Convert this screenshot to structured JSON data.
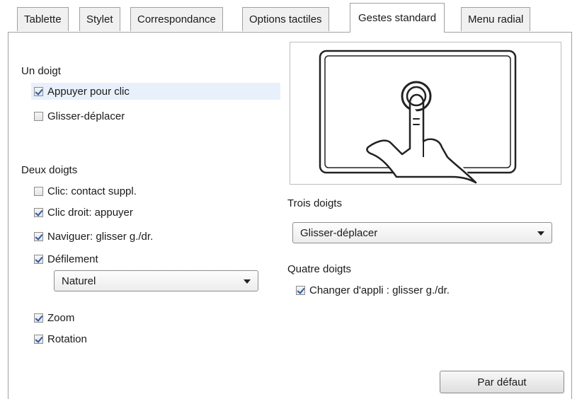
{
  "tabs": [
    {
      "label": "Tablette"
    },
    {
      "label": "Stylet"
    },
    {
      "label": "Correspondance"
    },
    {
      "label": "Options tactiles"
    },
    {
      "label": "Gestes standard"
    },
    {
      "label": "Menu radial"
    }
  ],
  "active_tab": "Gestes standard",
  "one_finger": {
    "title": "Un doigt",
    "options": [
      {
        "label": "Appuyer pour clic",
        "checked": true
      },
      {
        "label": "Glisser-déplacer",
        "checked": false
      }
    ]
  },
  "two_fingers": {
    "title": "Deux doigts",
    "options": [
      {
        "label": "Clic: contact suppl.",
        "checked": false
      },
      {
        "label": "Clic droit: appuyer",
        "checked": true
      },
      {
        "label": "Naviguer: glisser g./dr.",
        "checked": true
      },
      {
        "label": "Défilement",
        "checked": true
      }
    ],
    "scroll_mode": "Naturel",
    "more_options": [
      {
        "label": "Zoom",
        "checked": true
      },
      {
        "label": "Rotation",
        "checked": true
      }
    ]
  },
  "three_fingers": {
    "title": "Trois doigts",
    "selected": "Glisser-déplacer"
  },
  "four_fingers": {
    "title": "Quatre doigts",
    "option": {
      "label": "Changer d'appli : glisser g./dr.",
      "checked": true
    }
  },
  "default_button": "Par défaut",
  "colors": {
    "checkmark": "#2d5aa8",
    "highlight": "#e8f1fb",
    "border": "#a0a0a0"
  },
  "icons": {
    "illustration": "tap-gesture-illustration",
    "dropdown": "chevron-down-icon"
  }
}
